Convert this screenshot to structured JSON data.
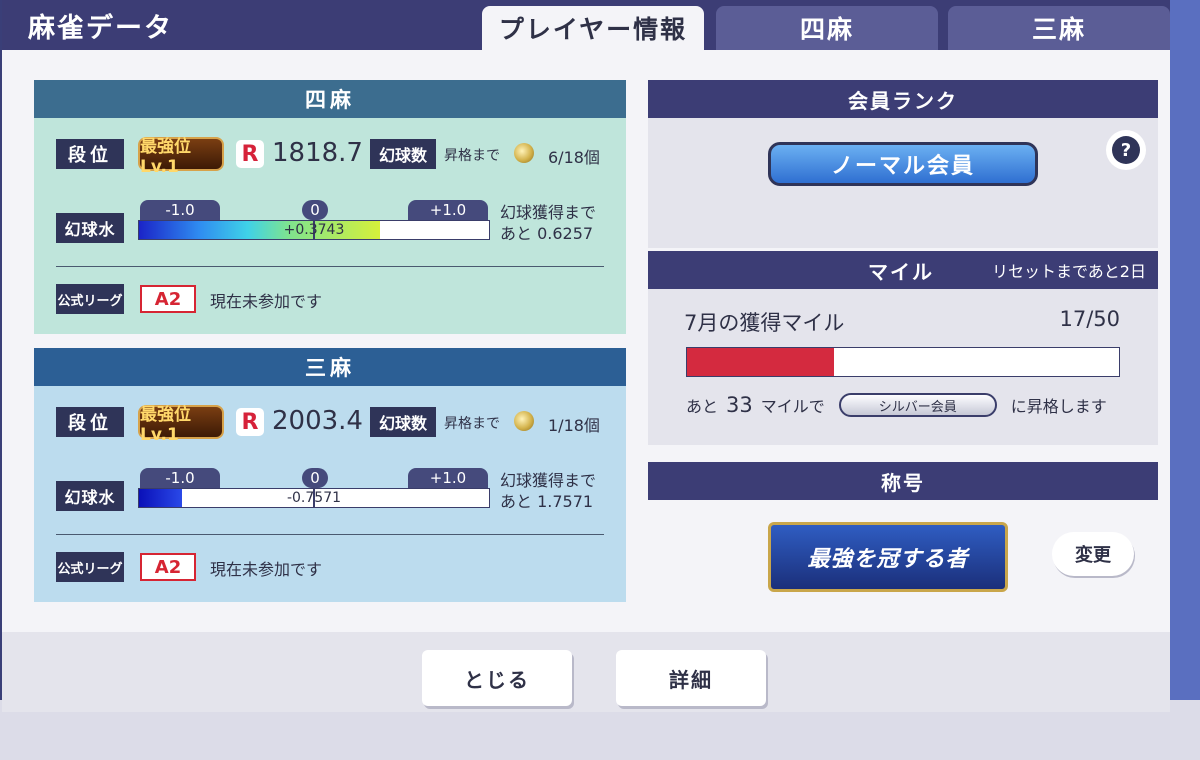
{
  "dialog": {
    "title": "麻雀データ",
    "tabs": [
      {
        "label": "プレイヤー情報",
        "active": true
      },
      {
        "label": "四麻",
        "active": false
      },
      {
        "label": "三麻",
        "active": false
      }
    ]
  },
  "yonma": {
    "header": "四麻",
    "dan_label": "段位",
    "rank_badge": "最強位Lv.1",
    "r_mark": "R",
    "rating": "1818.7",
    "genkyu_label": "幻球数",
    "promo_label": "昇格まで",
    "promo_count": "6/18個",
    "mizu_label": "幻球水",
    "bar_min": "-1.0",
    "bar_zero": "0",
    "bar_max": "+1.0",
    "bar_value": "+0.3743",
    "bar_value_num": 0.3743,
    "acquire_line1": "幻球獲得まで",
    "acquire_line2": "あと 0.6257",
    "league_label": "公式リーグ",
    "league_rank": "A2",
    "league_status": "現在未参加です"
  },
  "sanma": {
    "header": "三麻",
    "dan_label": "段位",
    "rank_badge": "最強位Lv.1",
    "r_mark": "R",
    "rating": "2003.4",
    "genkyu_label": "幻球数",
    "promo_label": "昇格まで",
    "promo_count": "1/18個",
    "mizu_label": "幻球水",
    "bar_min": "-1.0",
    "bar_zero": "0",
    "bar_max": "+1.0",
    "bar_value": "-0.7571",
    "bar_value_num": -0.7571,
    "acquire_line1": "幻球獲得まで",
    "acquire_line2": "あと 1.7571",
    "league_label": "公式リーグ",
    "league_rank": "A2",
    "league_status": "現在未参加です"
  },
  "member": {
    "header": "会員ランク",
    "rank_button": "ノーマル会員",
    "help_icon": "?"
  },
  "mile": {
    "header": "マイル",
    "reset_note": "リセットまであと2日",
    "title": "7月の獲得マイル",
    "count": "17/50",
    "current": 17,
    "max": 50,
    "remain_prefix": "あと",
    "remain_num": "33",
    "remain_mid": "マイルで",
    "target_chip": "シルバー会員",
    "remain_suffix": "に昇格します"
  },
  "title_section": {
    "header": "称号",
    "title_name": "最強を冠する者",
    "change_button": "変更"
  },
  "footer": {
    "close_button": "とじる",
    "detail_button": "詳細"
  },
  "colors": {
    "header_navy": "#3c3d75",
    "yonma_panel": "#bfe5db",
    "sanma_panel": "#bcdcee",
    "mile_fill": "#d42a3f",
    "league_red": "#d62533"
  }
}
